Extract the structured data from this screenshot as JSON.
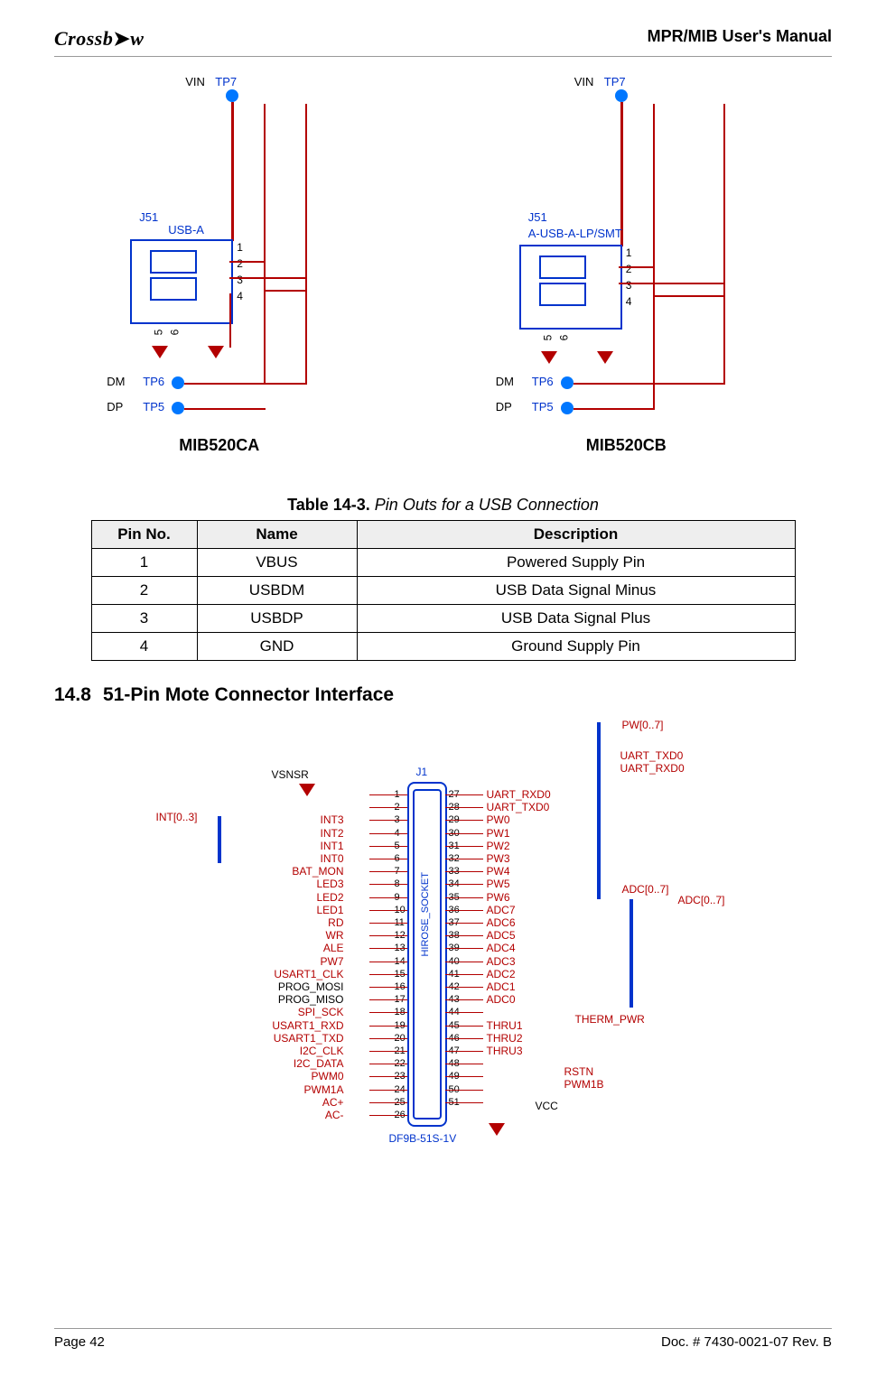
{
  "header": {
    "logo_text": "Crossb",
    "manual_title": "MPR/MIB User's Manual"
  },
  "footer": {
    "page_left": "Page 42",
    "doc_right": "Doc. # 7430-0021-07 Rev. B"
  },
  "schematic_common": {
    "vin": "VIN",
    "tp7": "TP7",
    "tp6": "TP6",
    "tp5": "TP5",
    "dm": "DM",
    "dp": "DP",
    "j51": "J51",
    "pin1": "1",
    "pin2": "2",
    "pin3": "3",
    "pin4": "4",
    "pin5": "5",
    "pin6": "6"
  },
  "schematic_a": {
    "connector_type": "USB-A",
    "board_label": "MIB520CA"
  },
  "schematic_b": {
    "connector_type": "A-USB-A-LP/SMT",
    "board_label": "MIB520CB"
  },
  "table_caption": {
    "number": "Table 14-3.",
    "title": "Pin Outs for a USB Connection"
  },
  "table": {
    "headers": [
      "Pin No.",
      "Name",
      "Description"
    ],
    "rows": [
      [
        "1",
        "VBUS",
        "Powered Supply Pin"
      ],
      [
        "2",
        "USBDM",
        "USB Data Signal Minus"
      ],
      [
        "3",
        "USBDP",
        "USB Data Signal Plus"
      ],
      [
        "4",
        "GND",
        "Ground Supply Pin"
      ]
    ]
  },
  "section": {
    "num": "14.8",
    "title": "51-Pin Mote Connector Interface"
  },
  "hirose": {
    "j1": "J1",
    "part": "DF9B-51S-1V",
    "vtext": "HIROSE_SOCKET",
    "vsnsr": "VSNSR",
    "int_bus": "INT[0..3]",
    "vcc": "VCC",
    "pw_bus": "PW[0..7]",
    "uart_txd0_top": "UART_TXD0",
    "uart_rxd0_top": "UART_RXD0",
    "adc_bus_l": "ADC[0..7]",
    "adc_bus_r": "ADC[0..7]",
    "therm_pwr": "THERM_PWR",
    "rstn": "RSTN",
    "pwm1b": "PWM1B",
    "left_labels": [
      "INT3",
      "INT2",
      "INT1",
      "INT0",
      "BAT_MON",
      "LED3",
      "LED2",
      "LED1",
      "RD",
      "WR",
      "ALE",
      "PW7",
      "USART1_CLK",
      "PROG_MOSI",
      "PROG_MISO",
      "SPI_SCK",
      "USART1_RXD",
      "USART1_TXD",
      "I2C_CLK",
      "I2C_DATA",
      "PWM0",
      "PWM1A",
      "AC+",
      "AC-"
    ],
    "left_pins": [
      "1",
      "2",
      "3",
      "4",
      "5",
      "6",
      "7",
      "8",
      "9",
      "10",
      "11",
      "12",
      "13",
      "14",
      "15",
      "16",
      "17",
      "18",
      "19",
      "20",
      "21",
      "22",
      "23",
      "24",
      "25",
      "26"
    ],
    "right_pins": [
      "27",
      "28",
      "29",
      "30",
      "31",
      "32",
      "33",
      "34",
      "35",
      "36",
      "37",
      "38",
      "39",
      "40",
      "41",
      "42",
      "43",
      "44",
      "45",
      "46",
      "47",
      "48",
      "49",
      "50",
      "51"
    ],
    "right_labels": [
      "UART_RXD0",
      "UART_TXD0",
      "PW0",
      "PW1",
      "PW2",
      "PW3",
      "PW4",
      "PW5",
      "PW6",
      "ADC7",
      "ADC6",
      "ADC5",
      "ADC4",
      "ADC3",
      "ADC2",
      "ADC1",
      "ADC0",
      "",
      "THRU1",
      "THRU2",
      "THRU3",
      "",
      "",
      "",
      ""
    ]
  }
}
